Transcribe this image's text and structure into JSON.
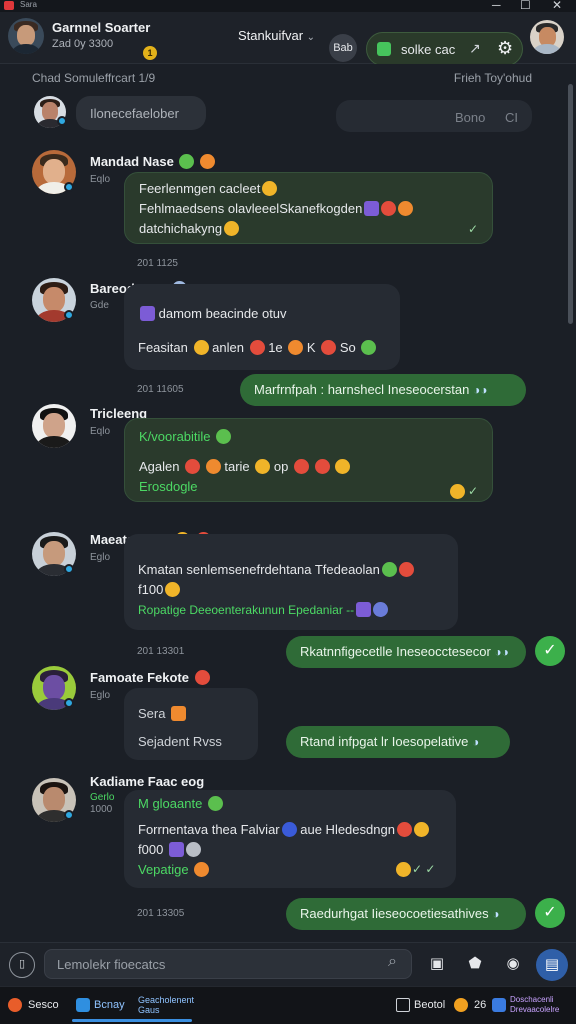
{
  "window": {
    "title": "Sara"
  },
  "header": {
    "name": "Garnnel Soarter",
    "status": "Zad 0y 3300",
    "coin": "1",
    "switcher": "Stankuifvar",
    "switcher_arrow": "⌄",
    "chip": "Bab",
    "pill_text": "solke cac",
    "pill_arrow": "↗",
    "settings_icon": "gear-icon"
  },
  "chat": {
    "subhead_left": "Chad Somuleffrcart 1/9",
    "subhead_right": "Frieh Toy'ohud",
    "top_bubble_left": "Ilonecefaelober",
    "top_bubble_right_a": "Bono",
    "top_bubble_right_b": "CI",
    "messages": [
      {
        "name": "Mandad Nase",
        "sub": "Eqlo",
        "lines": [
          "Feerlenmgen cacleet",
          "Fehlmaedsens olavleeelSkanefkogden",
          "datchichakyng"
        ],
        "time": "201 1125"
      },
      {
        "name": "Bareod Fear",
        "sub": "Gde",
        "lines": [
          "damom beacinde otuv",
          "Feasitan",
          "anlen",
          "1e",
          "K",
          "So"
        ],
        "time": "201 11605"
      },
      {
        "name": "Tricleeng",
        "sub": "Eqlo",
        "lines": [
          "K/voorabitile",
          "Agalen",
          "tarie",
          "op",
          "Erosdogle"
        ]
      },
      {
        "name": "Maeate Rdya",
        "sub": "Eglo",
        "lines": [
          "Kmatan senlemsenefrdehtana Tfedeaolan",
          "f100",
          "Ropatige Deeoenterakunun Epedaniar --"
        ],
        "time": "201 13301"
      },
      {
        "name": "Famoate Fekote",
        "sub": "Eglo",
        "lines": [
          "Sera",
          "Sejadent Rvss"
        ]
      },
      {
        "name": "Kadiame Faac eog",
        "sub": "Gerlo",
        "sub2": "1000",
        "lines": [
          "M gloaante",
          "Forrnentava thea Falviar",
          "aue Hledesdngn",
          "f000",
          "Vepatige"
        ],
        "time": "201 13305"
      }
    ],
    "outgoing": [
      "Marfrnfpah : harnshecl Ineseocerstan",
      "Rkatnnfigecetlle Ineseocctesecor",
      "Rtand infpgat lr Ioesopelative",
      "Raedurhgat Iieseocoetiesathives"
    ]
  },
  "composer": {
    "placeholder": "Lemolekr fioecatcs",
    "value": ""
  },
  "taskbar": {
    "item1": "Sesco",
    "item2": "Bcnay",
    "item3_a": "Geacholenent",
    "item3_b": "Gaus",
    "item4": "Beotol",
    "item5": "26",
    "item6_a": "Doschacenli",
    "item6_b": "Drevaacolelre"
  },
  "colors": {
    "background": "#1b1f26",
    "accent_green": "#2f6b37",
    "online_blue": "#2fa8e0",
    "send_blue": "#2f5fa8"
  }
}
